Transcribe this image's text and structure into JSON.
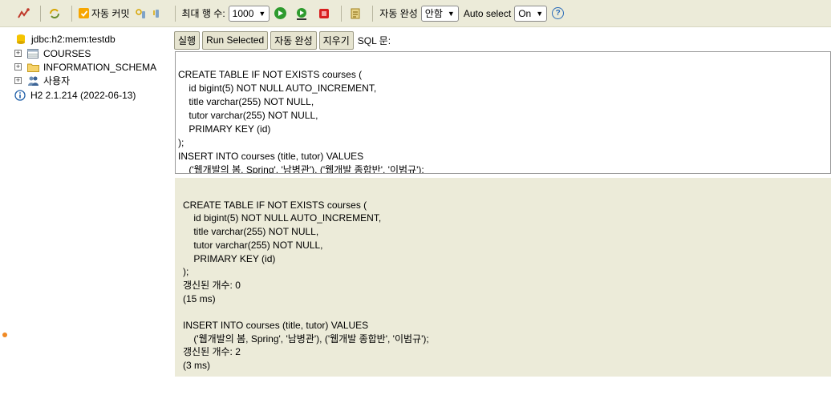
{
  "toolbar": {
    "autocommit_label": "자동 커밋",
    "max_rows_label": "최대 행 수:",
    "max_rows_value": "1000",
    "autocomplete_label": "자동 완성",
    "autocomplete_value": "안함",
    "autoselect_label": "Auto select",
    "autoselect_value": "On",
    "colors": {
      "bar": "#ecebd9",
      "run": "#2e9b2e",
      "stop": "#d81f1f",
      "check": "#f7a600"
    }
  },
  "tree": {
    "connection": "jdbc:h2:mem:testdb",
    "items": [
      {
        "label": "COURSES",
        "icon": "table-icon"
      },
      {
        "label": "INFORMATION_SCHEMA",
        "icon": "folder-icon"
      },
      {
        "label": "사용자",
        "icon": "users-icon"
      }
    ],
    "version": "H2 2.1.214 (2022-06-13)"
  },
  "buttons": {
    "run": "실행",
    "run_selected": "Run Selected",
    "autocomplete": "자동 완성",
    "clear": "지우기",
    "sql_label": "SQL 문:"
  },
  "editor": {
    "lines": [
      "CREATE TABLE IF NOT EXISTS courses (",
      "    id bigint(5) NOT NULL AUTO_INCREMENT,",
      "    title varchar(255) NOT NULL,",
      "    tutor varchar(255) NOT NULL,",
      "    PRIMARY KEY (id)",
      ");",
      "INSERT INTO courses (title, tutor) VALUES",
      "    ('웹개발의 봄, Spring', '남병관'), ('웹개발 종합반', '이범규');"
    ]
  },
  "result": {
    "lines": [
      "CREATE TABLE IF NOT EXISTS courses (",
      "    id bigint(5) NOT NULL AUTO_INCREMENT,",
      "    title varchar(255) NOT NULL,",
      "    tutor varchar(255) NOT NULL,",
      "    PRIMARY KEY (id)",
      ");",
      "갱신된 개수: 0",
      "(15 ms)",
      "",
      "INSERT INTO courses (title, tutor) VALUES",
      "    ('웹개발의 봄, Spring', '남병관'), ('웹개발 종합반', '이범규');",
      "갱신된 개수: 2",
      "(3 ms)"
    ]
  }
}
